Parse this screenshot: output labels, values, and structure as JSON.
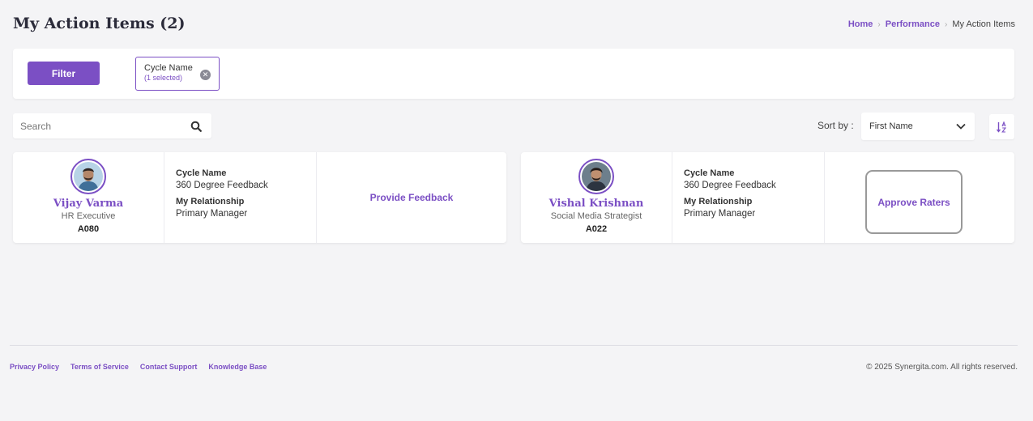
{
  "page": {
    "title": "My Action Items (2)"
  },
  "breadcrumb": {
    "home": "Home",
    "performance": "Performance",
    "current": "My Action Items"
  },
  "filter": {
    "button_label": "Filter",
    "chip_label": "Cycle Name",
    "chip_sub": "(1 selected)"
  },
  "search": {
    "placeholder": "Search"
  },
  "sort": {
    "label": "Sort by :",
    "selected": "First Name"
  },
  "cards": [
    {
      "name": "Vijay Varma",
      "role": "HR Executive",
      "id": "A080",
      "cycle_label": "Cycle Name",
      "cycle_value": "360 Degree Feedback",
      "relationship_label": "My Relationship",
      "relationship_value": "Primary Manager",
      "action": "Provide Feedback"
    },
    {
      "name": "Vishal Krishnan",
      "role": "Social Media Strategist",
      "id": "A022",
      "cycle_label": "Cycle Name",
      "cycle_value": "360 Degree Feedback",
      "relationship_label": "My Relationship",
      "relationship_value": "Primary Manager",
      "action": "Approve Raters"
    }
  ],
  "footer": {
    "links": [
      "Privacy Policy",
      "Terms of Service",
      "Contact Support",
      "Knowledge Base"
    ],
    "copyright": "© 2025 Synergita.com. All rights reserved."
  },
  "colors": {
    "accent": "#7b4fc4",
    "background": "#f4f4f6"
  }
}
